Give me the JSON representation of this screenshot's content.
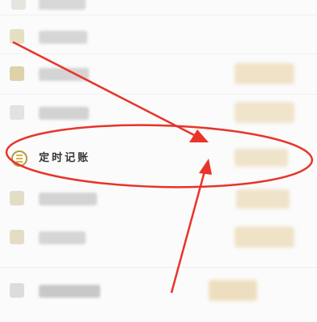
{
  "menu": {
    "scheduled_booking": {
      "label": "定时记账",
      "icon": "timer-ledger-icon"
    }
  },
  "annotation": {
    "color": "#e8342b",
    "shapes": [
      "ellipse-highlight",
      "arrow-from-top-left",
      "arrow-from-bottom"
    ]
  }
}
